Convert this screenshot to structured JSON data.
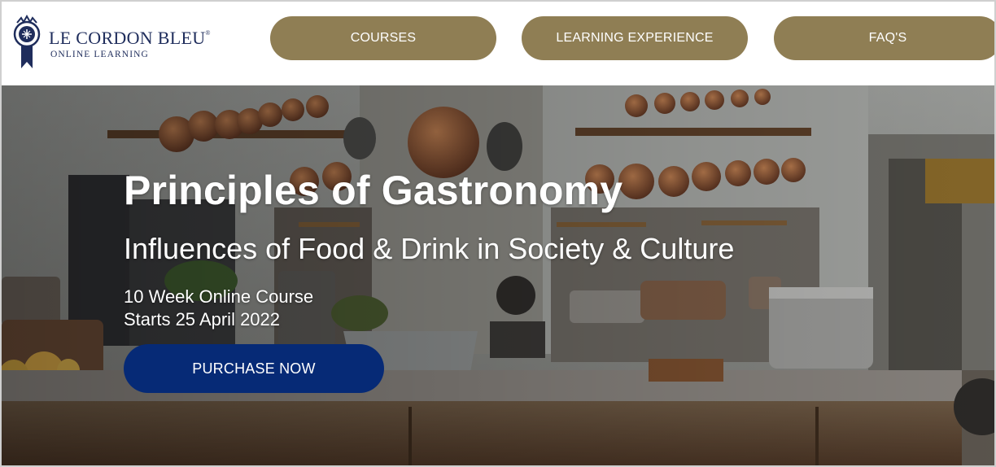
{
  "brand": {
    "name": "LE CORDON BLEU",
    "registered": "®",
    "tagline": "ONLINE LEARNING",
    "colors": {
      "navy": "#1f2d5c",
      "gold": "#8f7e54",
      "button_blue": "#062a76"
    }
  },
  "nav": {
    "items": [
      {
        "label": "COURSES"
      },
      {
        "label": "LEARNING EXPERIENCE"
      },
      {
        "label": "FAQ'S"
      }
    ]
  },
  "hero": {
    "title": "Principles of Gastronomy",
    "subtitle": "Influences of Food & Drink in Society & Culture",
    "duration": "10 Week Online Course",
    "start_date": "Starts 25 April 2022",
    "cta_label": "PURCHASE NOW",
    "background_image": "kitchen-with-copper-pans"
  }
}
